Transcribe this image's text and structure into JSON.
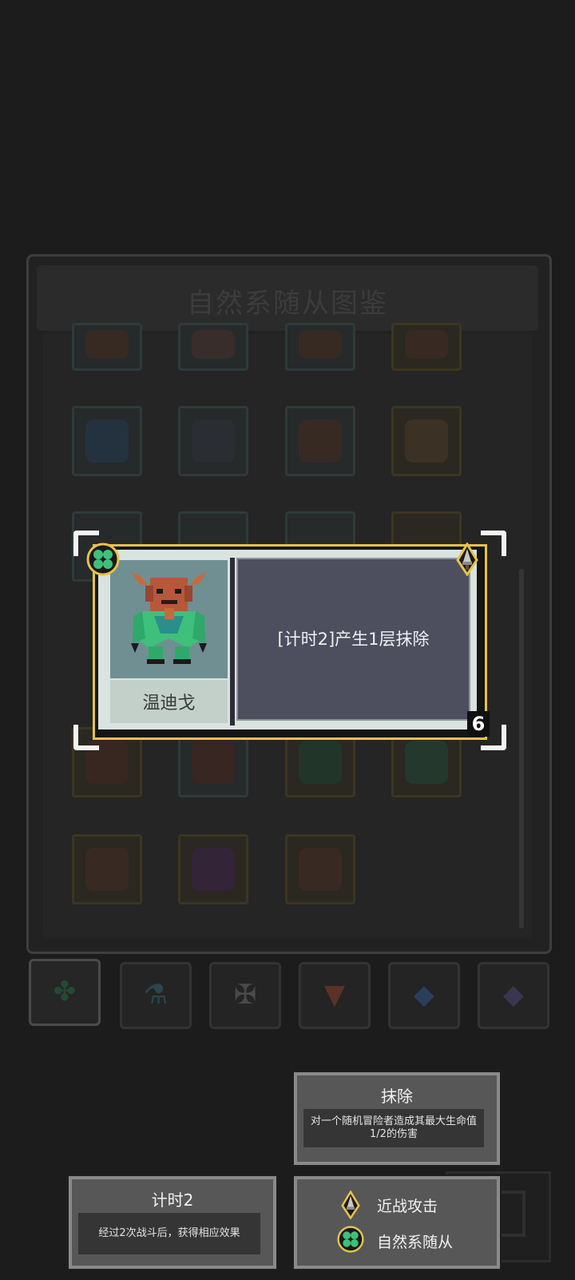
{
  "background_panel": {
    "title": "自然系随从图鉴",
    "tabs": [
      {
        "icon": "clover-icon",
        "active": true
      },
      {
        "icon": "flask-icon",
        "active": false
      },
      {
        "icon": "bone-cross-icon",
        "active": false
      },
      {
        "icon": "fox-head-icon",
        "active": false
      },
      {
        "icon": "diamond-icon",
        "active": false
      },
      {
        "icon": "diamond-icon",
        "active": false
      }
    ]
  },
  "card": {
    "name": "温迪戈",
    "description": "[计时2]产生1层抹除",
    "cost": "6",
    "type_icon": "clover-icon",
    "attack_icon": "dagger-icon",
    "colors": {
      "frame": "#e6c24a",
      "portrait_bg": "#6f8f93",
      "desc_bg": "#4d4f5f"
    }
  },
  "tooltips": {
    "erase": {
      "title": "抹除",
      "body": "对一个随机冒险者造成其最大生命值1/2的伤害"
    },
    "timer": {
      "title": "计时2",
      "body": "经过2次战斗后，获得相应效果"
    },
    "tags": {
      "melee": "近战攻击",
      "nature": "自然系随从"
    }
  }
}
